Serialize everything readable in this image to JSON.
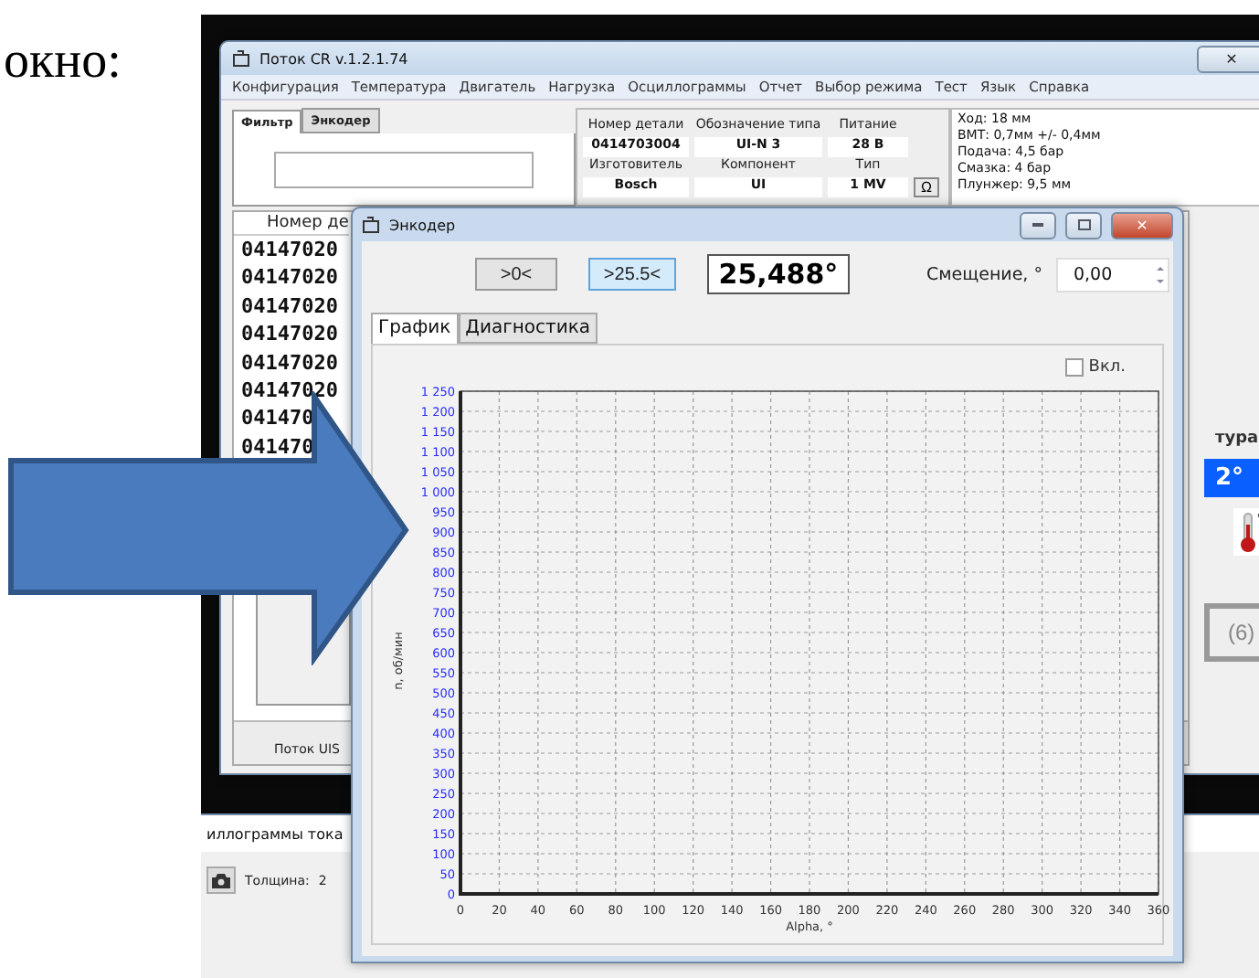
{
  "caption": "окно:",
  "main_window": {
    "title": "Поток CR v.1.2.1.74",
    "close_button": "✕",
    "menu": [
      "Конфигурация",
      "Температура",
      "Двигатель",
      "Нагрузка",
      "Осциллограммы",
      "Отчет",
      "Выбор режима",
      "Тест",
      "Язык",
      "Справка"
    ],
    "filter_tabs": [
      {
        "label": "Фильтр",
        "selected": true
      },
      {
        "label": "Энкодер",
        "selected": false
      }
    ],
    "part_info": [
      {
        "label": "Номер детали",
        "value": "0414703004"
      },
      {
        "label": "Обозначение типа",
        "value": "UI-N 3"
      },
      {
        "label": "Питание",
        "value": "28 В"
      },
      {
        "label": "Изготовитель",
        "value": "Bosch"
      },
      {
        "label": "Компонент",
        "value": "UI"
      },
      {
        "label": "Тип",
        "value": "1 MV"
      }
    ],
    "ohm_button": "Ω",
    "specs": [
      "Ход: 18 мм",
      "ВМТ: 0,7мм +/- 0,4мм",
      "Подача: 4,5 бар",
      "Смазка: 4 бар",
      "Плунжер: 9,5 мм"
    ],
    "list_header": "Номер де",
    "list_rows": [
      "04147020",
      "04147020",
      "04147020",
      "04147020",
      "04147020",
      "04147020",
      "041470",
      "041470"
    ],
    "status": "Поток UIS",
    "temperature_label": "тура",
    "temperature_value": "2°",
    "count_button": "(6)"
  },
  "oscillogram_window": {
    "title": "иллограммы тока",
    "thickness_label": "Толщина:",
    "thickness_value": "2"
  },
  "encoder_window": {
    "title": "Энкодер",
    "close_button": "✕",
    "buttons": [
      {
        "label": ">0<",
        "selected": false
      },
      {
        "label": ">25.5<",
        "selected": true
      }
    ],
    "angle": "25,488°",
    "offset_label": "Смещение, °",
    "offset_value": "0,00",
    "tabs": [
      {
        "label": "График",
        "selected": true
      },
      {
        "label": "Диагностика",
        "selected": false
      }
    ],
    "enable": {
      "label": "Вкл.",
      "checked": false
    },
    "chart_data": {
      "type": "line",
      "grid": true,
      "xlabel": "Alpha, °",
      "ylabel": "n, об/мин",
      "xlim": [
        0,
        360
      ],
      "ylim": [
        0,
        1250
      ],
      "xticks": [
        0,
        20,
        40,
        60,
        80,
        100,
        120,
        140,
        160,
        180,
        200,
        220,
        240,
        260,
        280,
        300,
        320,
        340,
        360
      ],
      "yticks": [
        0,
        50,
        100,
        150,
        200,
        250,
        300,
        350,
        400,
        450,
        500,
        550,
        600,
        650,
        700,
        750,
        800,
        850,
        900,
        950,
        {
          "value": 1000,
          "label": "1 000"
        },
        {
          "value": 1050,
          "label": "1 050"
        },
        {
          "value": 1100,
          "label": "1 100"
        },
        {
          "value": 1150,
          "label": "1 150"
        },
        {
          "value": 1200,
          "label": "1 200"
        },
        {
          "value": 1250,
          "label": "1 250"
        }
      ]
    }
  }
}
